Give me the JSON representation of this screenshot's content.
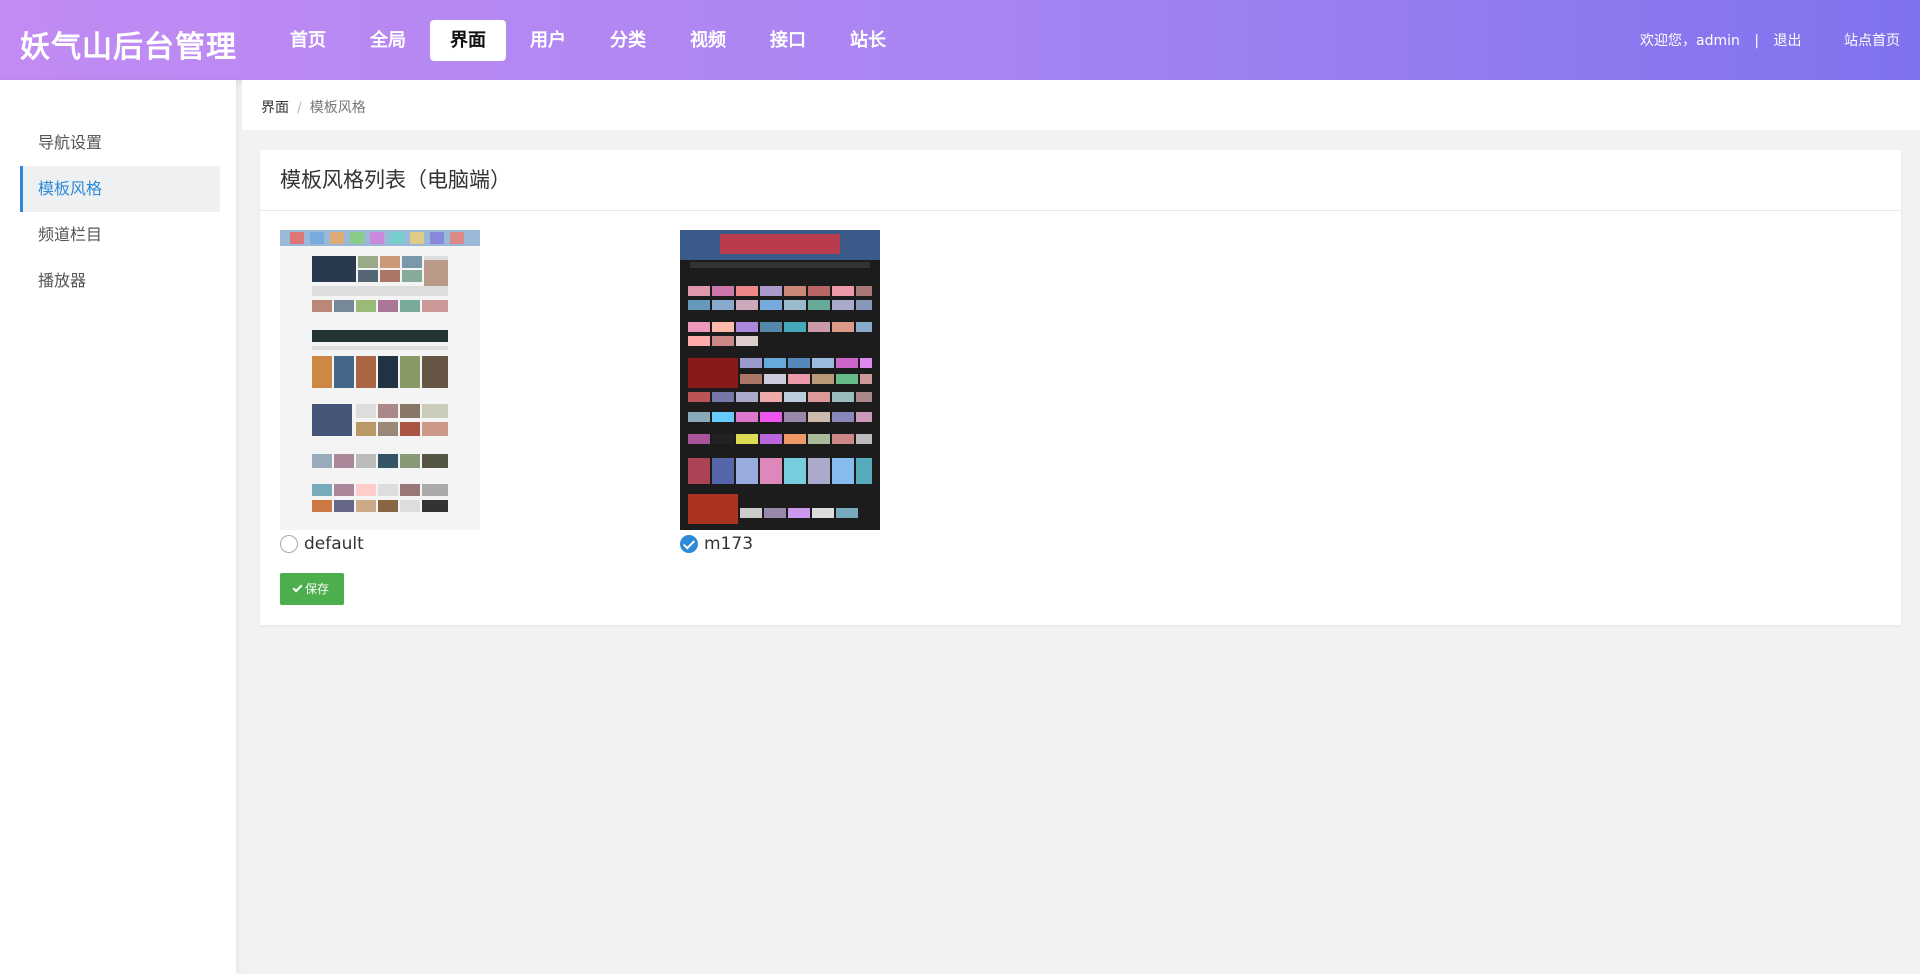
{
  "header": {
    "brand": "妖气山后台管理",
    "nav": [
      "首页",
      "全局",
      "界面",
      "用户",
      "分类",
      "视频",
      "接口",
      "站长"
    ],
    "active_nav": "界面",
    "welcome": "欢迎您，admin",
    "separator": "|",
    "logout": "退出",
    "site_home": "站点首页"
  },
  "sidebar": {
    "items": [
      {
        "label": "导航设置",
        "active": false
      },
      {
        "label": "模板风格",
        "active": true
      },
      {
        "label": "频道栏目",
        "active": false
      },
      {
        "label": "播放器",
        "active": false
      }
    ]
  },
  "breadcrumb": {
    "items": [
      "界面",
      "模板风格"
    ]
  },
  "card": {
    "title": "模板风格列表（电脑端）",
    "templates": [
      {
        "name": "default",
        "selected": false,
        "thumb_bg": "#ffffff"
      },
      {
        "name": "m173",
        "selected": true,
        "thumb_bg": "#1a1a1a"
      }
    ],
    "save_label": "保存"
  },
  "colors": {
    "header_gradient_start": "#c28bf3",
    "header_gradient_end": "#7f72ee",
    "accent_blue": "#2e8ad8",
    "save_green": "#4cae4c"
  }
}
